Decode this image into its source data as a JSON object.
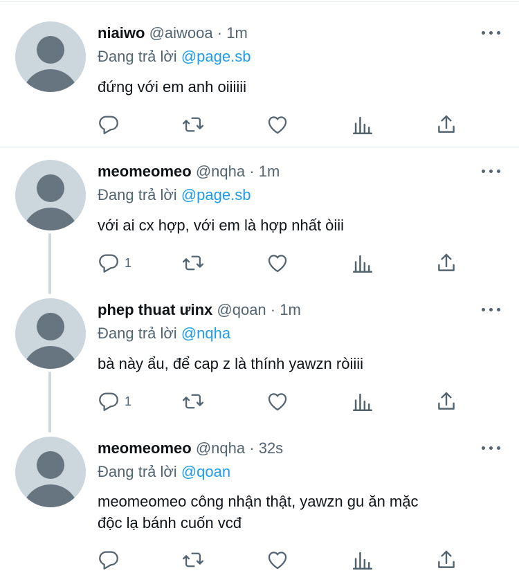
{
  "tweets": [
    {
      "name": "niaiwo",
      "handle": "@aiwooa",
      "dot": "·",
      "time": "1m",
      "reply_prefix": "Đang trả lời",
      "reply_mention": "@page.sb",
      "text": "đứng với em anh oiiiiii",
      "reply_count": ""
    },
    {
      "name": "meomeomeo",
      "handle": "@nqha",
      "dot": "·",
      "time": "1m",
      "reply_prefix": "Đang trả lời",
      "reply_mention": "@page.sb",
      "text": "với ai cx hợp, với em là hợp nhất òiii",
      "reply_count": "1"
    },
    {
      "name": "phep thuat ưinx",
      "handle": "@qoan",
      "dot": "·",
      "time": "1m",
      "reply_prefix": "Đang trả lời",
      "reply_mention": "@nqha",
      "text": "bà này ẩu, để cap z là thính yawzn ròiiii",
      "reply_count": "1"
    },
    {
      "name": "meomeomeo",
      "handle": "@nqha",
      "dot": "·",
      "time": "32s",
      "reply_prefix": "Đang trả lời",
      "reply_mention": "@qoan",
      "text": "meomeomeo công nhận thật, yawzn gu ăn mặc\nđộc lạ bánh cuốn vcđ",
      "reply_count": ""
    }
  ],
  "icons": {
    "reply": "reply-icon",
    "retweet": "retweet-icon",
    "like": "heart-icon",
    "analytics": "analytics-icon",
    "share": "share-icon",
    "more": "more-options-icon"
  },
  "colors": {
    "link": "#1d9bf0",
    "secondary_text": "#536471",
    "primary_text": "#0f1419",
    "avatar_bg": "#ccd6dd",
    "avatar_fg": "#66757f",
    "thread_line": "#cfd9de"
  }
}
